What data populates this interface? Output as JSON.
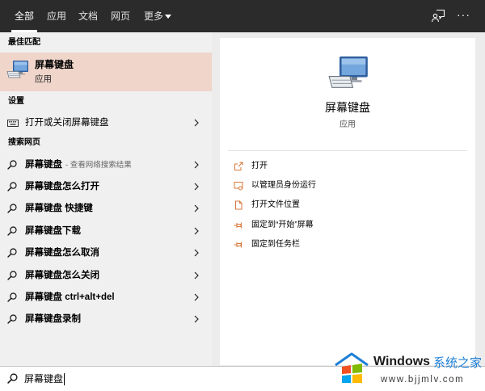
{
  "colors": {
    "topbar": "#2b2b2b",
    "panel": "#f0f0f0",
    "selected": "#efd5ca",
    "card": "#ffffff",
    "action_icon": "#d9773a",
    "brand_blue": "#1e7fd6"
  },
  "topbar": {
    "tabs": [
      {
        "label": "全部",
        "active": true
      },
      {
        "label": "应用",
        "active": false
      },
      {
        "label": "文档",
        "active": false
      },
      {
        "label": "网页",
        "active": false
      },
      {
        "label": "更多",
        "active": false,
        "icon": "chevron-down-icon"
      }
    ],
    "feedback_icon": "feedback-icon",
    "more_options": "···"
  },
  "left": {
    "best_match": {
      "header": "最佳匹配",
      "icon": "on-screen-keyboard-icon",
      "title": "屏幕键盘",
      "subtitle": "应用"
    },
    "settings": {
      "header": "设置",
      "items": [
        {
          "icon": "keyboard-icon",
          "label": "打开或关闭屏幕键盘"
        }
      ]
    },
    "web": {
      "header": "搜索网页",
      "icon": "search-icon",
      "items": [
        {
          "label": "屏幕键盘",
          "hint": "- 查看网络搜索结果"
        },
        {
          "label": "屏幕键盘怎么打开"
        },
        {
          "label": "屏幕键盘 快捷键"
        },
        {
          "label": "屏幕键盘下载"
        },
        {
          "label": "屏幕键盘怎么取消"
        },
        {
          "label": "屏幕键盘怎么关闭"
        },
        {
          "label": "屏幕键盘 ctrl+alt+del"
        },
        {
          "label": "屏幕键盘录制"
        }
      ]
    }
  },
  "preview": {
    "icon": "on-screen-keyboard-icon",
    "title": "屏幕键盘",
    "subtitle": "应用",
    "actions": [
      {
        "icon": "open-icon",
        "label": "打开"
      },
      {
        "icon": "run-as-admin-icon",
        "label": "以管理员身份运行"
      },
      {
        "icon": "file-location-icon",
        "label": "打开文件位置"
      },
      {
        "icon": "pin-icon",
        "label": "固定到“开始”屏幕"
      },
      {
        "icon": "pin-icon",
        "label": "固定到任务栏"
      }
    ]
  },
  "search": {
    "icon": "search-icon",
    "value": "屏幕键盘"
  },
  "watermark": {
    "icon": "windows-logo-icon",
    "brand": "Windows",
    "name": "系统之家",
    "url": "www.bjjmlv.com"
  }
}
